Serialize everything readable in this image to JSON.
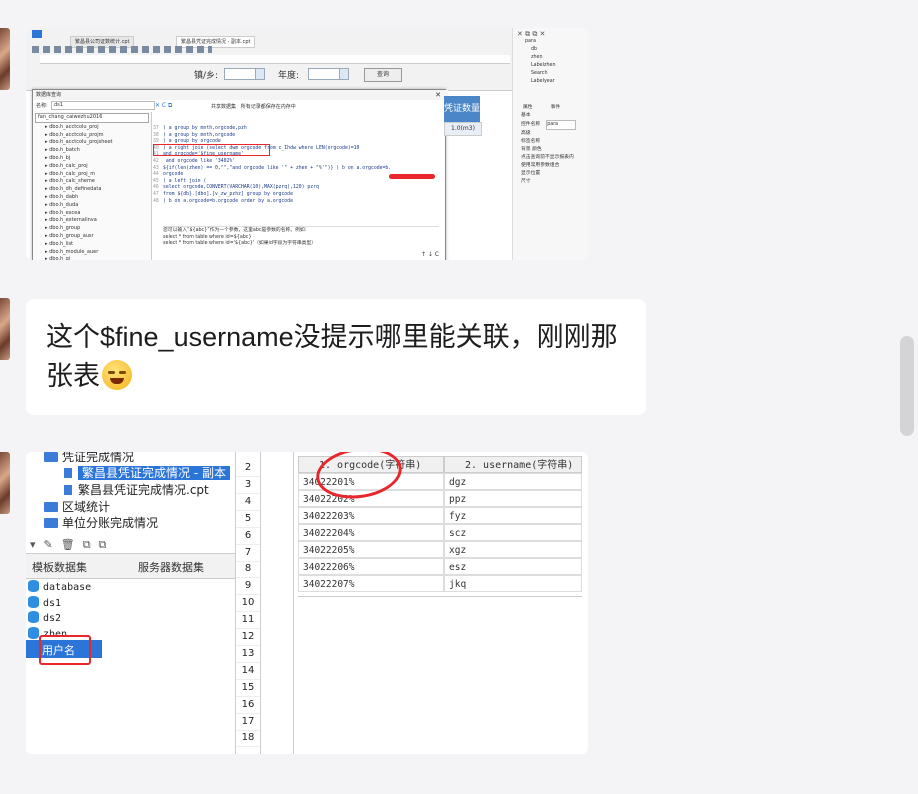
{
  "screenshot1": {
    "tabs": [
      "繁昌县公司证数统计.cpt",
      "繁昌县凭证完成情况 - 副本.cpt"
    ],
    "params": {
      "town_label": "镇/乡:",
      "year_label": "年度:",
      "query_button": "查询"
    },
    "dialog": {
      "title": "数据库查询",
      "name_label": "名称:",
      "name_value": "ds1",
      "connection": "fan_chang_caiwezhu2016",
      "options": [
        "共享数据集",
        "所有记录都保存在内存中"
      ],
      "tree_items": [
        "dbo.h_acctcolu_proj",
        "dbo.h_acctcolu_projm",
        "dbo.h_acctcolu_projsheet",
        "dbo.h_batch",
        "dbo.h_bj",
        "dbo.h_calc_proj",
        "dbo.h_calc_proj_m",
        "dbo.h_calc_sheme",
        "dbo.h_dh_definedata",
        "dbo.h_dabh",
        "dbo.h_duda",
        "dbo.h_excea",
        "dbo.h_externalinva",
        "dbo.h_group",
        "dbo.h_group_ausr",
        "dbo.h_list",
        "dbo.h_module_auer",
        "dbo.h_qi"
      ],
      "code_lines": [
        {
          "n": "37",
          "t": ") a group by mnth,orgcode,pzh"
        },
        {
          "n": "38",
          "t": ") a group by mnth,orgcode"
        },
        {
          "n": "39",
          "t": ") a group by orgcode"
        },
        {
          "n": "40",
          "t": ") a right join (select dwm orgcode from c_Ihdw where LEN(orgcode)=10"
        },
        {
          "n": "41",
          "t": "and orgcode='$fine_username'"
        },
        {
          "n": "42",
          "t": " and orgcode like '3402%'"
        },
        {
          "n": "43",
          "t": "${if(len(zhen) == 0,\"\",\"and orgcode like '\" + zhen + \"%'\")} ) b on a.orgcode=b."
        },
        {
          "n": "44",
          "t": "orgcode"
        },
        {
          "n": "45",
          "t": ") a left join ("
        },
        {
          "n": "46",
          "t": "select orgcode,CONVERT(VARCHAR(10),MAX(pzrq),120) pzrq"
        },
        {
          "n": "47",
          "t": "from ${db}.[dbo].[v_zw_pzhz] group by orgcode"
        },
        {
          "n": "48",
          "t": ") b on a.orgcode=b.orgcode order by a.orgcode"
        }
      ],
      "hint_lines": [
        "您可以输入“${abc}”作为一个参数，这里abc是参数的名称。例如:",
        "select * from table where id=${abc}",
        "select * from table where id='${abc}'（如果id字段为字符串类型）"
      ]
    },
    "grid": {
      "header": "凭证数量",
      "cell": "1.0(m3)"
    },
    "right_panel": {
      "tree": [
        "para",
        "db",
        "zhen",
        "Labelzhen",
        "Search",
        "Labelyear"
      ],
      "tabs": [
        "属性",
        "事件"
      ],
      "props": [
        "基本",
        "控件名称",
        "高级",
        "标签名称",
        "背景  颜色",
        "点击查询前不显示报表内",
        "使用常用参数组合",
        "显示位置",
        "尺寸"
      ],
      "widget_name_value": "para"
    }
  },
  "message": {
    "text": "这个$fine_username没提示哪里能关联，刚刚那张表"
  },
  "screenshot2": {
    "tree": [
      {
        "label": "凭证完成情况",
        "type": "folder"
      },
      {
        "label": "繁昌县凭证完成情况 - 副本",
        "type": "file",
        "selected": true
      },
      {
        "label": "繁昌县凭证完成情况.cpt",
        "type": "file"
      },
      {
        "label": "区域统计",
        "type": "folder"
      },
      {
        "label": "单位分账完成情况",
        "type": "folder"
      }
    ],
    "tabs": [
      "模板数据集",
      "服务器数据集"
    ],
    "datasets": [
      "database",
      "ds1",
      "ds2",
      "zhen"
    ],
    "selected_param": "用户名",
    "row_numbers": [
      "2",
      "3",
      "4",
      "5",
      "6",
      "7",
      "8",
      "9",
      "10",
      "11",
      "12",
      "13",
      "14",
      "15",
      "16",
      "17",
      "18"
    ],
    "columns": [
      "1. orgcode(字符串)",
      "2. username(字符串)"
    ],
    "rows": [
      [
        "34022201%",
        "dgz"
      ],
      [
        "34022202%",
        "ppz"
      ],
      [
        "34022203%",
        "fyz"
      ],
      [
        "34022204%",
        "scz"
      ],
      [
        "34022205%",
        "xgz"
      ],
      [
        "34022206%",
        "esz"
      ],
      [
        "34022207%",
        "jkq"
      ]
    ]
  },
  "colors": {
    "accent": "#2c75d8",
    "highlight": "#e8262b",
    "background": "#f4f4f6"
  }
}
